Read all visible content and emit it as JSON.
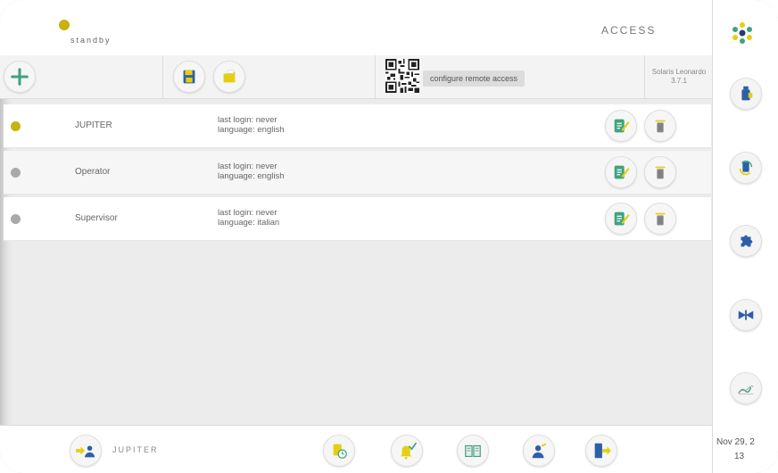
{
  "header": {
    "status": "standby",
    "title": "ACCESS"
  },
  "toolbar": {
    "remote_access_label": "configure remote access",
    "version_name": "Solaris Leonardo",
    "version_number": "3.7.1"
  },
  "users": [
    {
      "name": "JUPITER",
      "last_login": "last login: never",
      "language": "language: english",
      "status_color": "#c8b20c"
    },
    {
      "name": "Operator",
      "last_login": "last login: never",
      "language": "language: english",
      "status_color": "#a9a9a9"
    },
    {
      "name": "Supervisor",
      "last_login": "last login: never",
      "language": "language: italian",
      "status_color": "#a9a9a9"
    }
  ],
  "footer": {
    "current_user": "JUPITER",
    "date": "Nov 29, 2",
    "time": "13"
  },
  "colors": {
    "accent_yellow": "#e6cf12",
    "accent_green": "#3fa37f",
    "accent_blue": "#2d5fa8"
  }
}
